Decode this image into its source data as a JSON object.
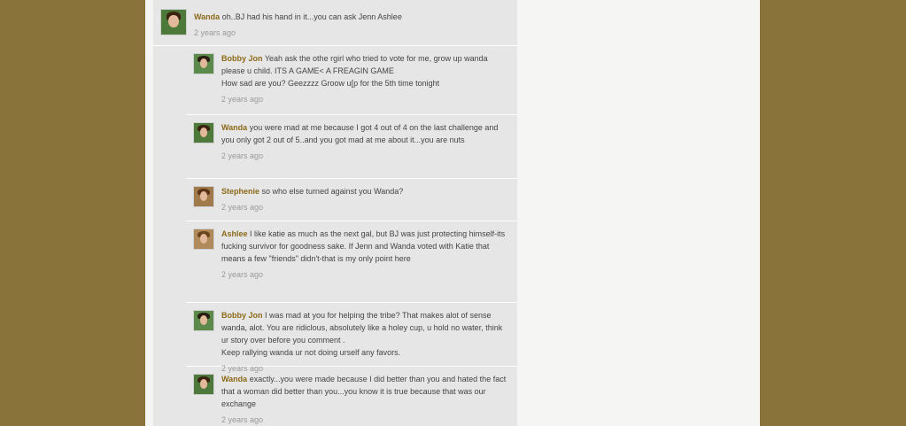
{
  "comments": [
    {
      "author": "Wanda",
      "text": "oh..BJ had his hand in it...you can ask Jenn Ashlee",
      "time": "2 years ago",
      "avatar_icon": "wanda-avatar-icon",
      "avatar_colors": {
        "bg": "#4d7a3a",
        "hair": "#3b2312"
      }
    },
    {
      "author": "Bobby Jon",
      "text": "Yeah ask the othe rgirl who tried to vote for me, grow up wanda please u child. ITS A GAME< A FREAGIN GAME\nHow sad are you?  Geezzzz Groow u[p for the 5th time tonight",
      "time": "2 years ago",
      "avatar_icon": "bobby-jon-avatar-icon",
      "avatar_colors": {
        "bg": "#5c8a4a",
        "hair": "#2a1e14"
      }
    },
    {
      "author": "Wanda",
      "text": "you were mad at me because I got 4 out of 4 on the last challenge and you only got 2 out of 5..and you got mad at me about it...you are nuts",
      "time": "2 years ago",
      "avatar_icon": "wanda-avatar-icon",
      "avatar_colors": {
        "bg": "#4d7a3a",
        "hair": "#3b2312"
      }
    },
    {
      "author": "Stephenie",
      "text": "so who else turned against you Wanda?",
      "time": "2 years ago",
      "avatar_icon": "stephenie-avatar-icon",
      "avatar_colors": {
        "bg": "#a07a4a",
        "hair": "#5a3418"
      }
    },
    {
      "author": "Ashlee",
      "text": "I like katie as much as the next gal, but BJ was just protecting himself-its fucking survivor for goodness sake.  If Jenn and Wanda voted with Katie that means a few \"friends\" didn't-that is my only point here",
      "time": "2 years ago",
      "avatar_icon": "ashlee-avatar-icon",
      "avatar_colors": {
        "bg": "#b08a5a",
        "hair": "#6b4420"
      }
    },
    {
      "author": "Bobby Jon",
      "text": "I was mad at you for helping the tribe? That makes alot of sense wanda, alot. You are ridiclous, absolutely like a holey cup, u hold no water, think ur story over before you comment .\nKeep rallying wanda ur not doing urself any favors.",
      "time": "2 years ago",
      "avatar_icon": "bobby-jon-avatar-icon",
      "avatar_colors": {
        "bg": "#5c8a4a",
        "hair": "#2a1e14"
      }
    },
    {
      "author": "Wanda",
      "text": "exactly...you were made because I did better than you and hated the fact that a woman did better than you...you know it is true because that was our exchange",
      "time": "2 years ago",
      "avatar_icon": "wanda-avatar-icon",
      "avatar_colors": {
        "bg": "#4d7a3a",
        "hair": "#3b2312"
      }
    }
  ]
}
